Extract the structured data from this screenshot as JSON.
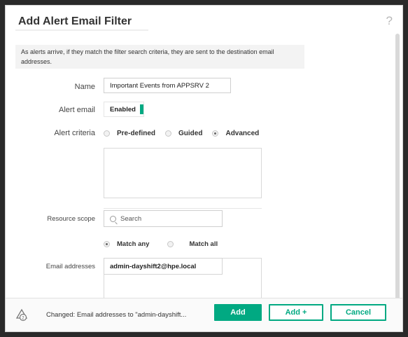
{
  "dialog": {
    "title": "Add Alert Email Filter",
    "help": "?",
    "description": "As  alerts arrive, if they match the filter search criteria, they are sent to the destination email addresses."
  },
  "form": {
    "name_label": "Name",
    "name_value": "Important Events from APPSRV 2",
    "alert_email_label": "Alert email",
    "alert_email_value": "Enabled",
    "alert_criteria_label": "Alert criteria",
    "criteria_options": [
      "Pre-defined",
      "Guided",
      "Advanced"
    ],
    "criteria_selected": "Advanced",
    "resource_scope_label": "Resource scope",
    "search_placeholder": "Search",
    "match_options": [
      "Match any",
      "Match all"
    ],
    "match_selected": "Match any",
    "email_label": "Email addresses",
    "email_value": "admin-dayshift2@hpe.local"
  },
  "footer": {
    "status": "Changed: Email addresses to \"admin-dayshift...",
    "add": "Add",
    "add_plus": "Add +",
    "cancel": "Cancel"
  },
  "colors": {
    "accent": "#01a982"
  },
  "icons": {
    "help": "question-mark-icon",
    "search": "search-icon",
    "status": "change-bell-icon"
  }
}
